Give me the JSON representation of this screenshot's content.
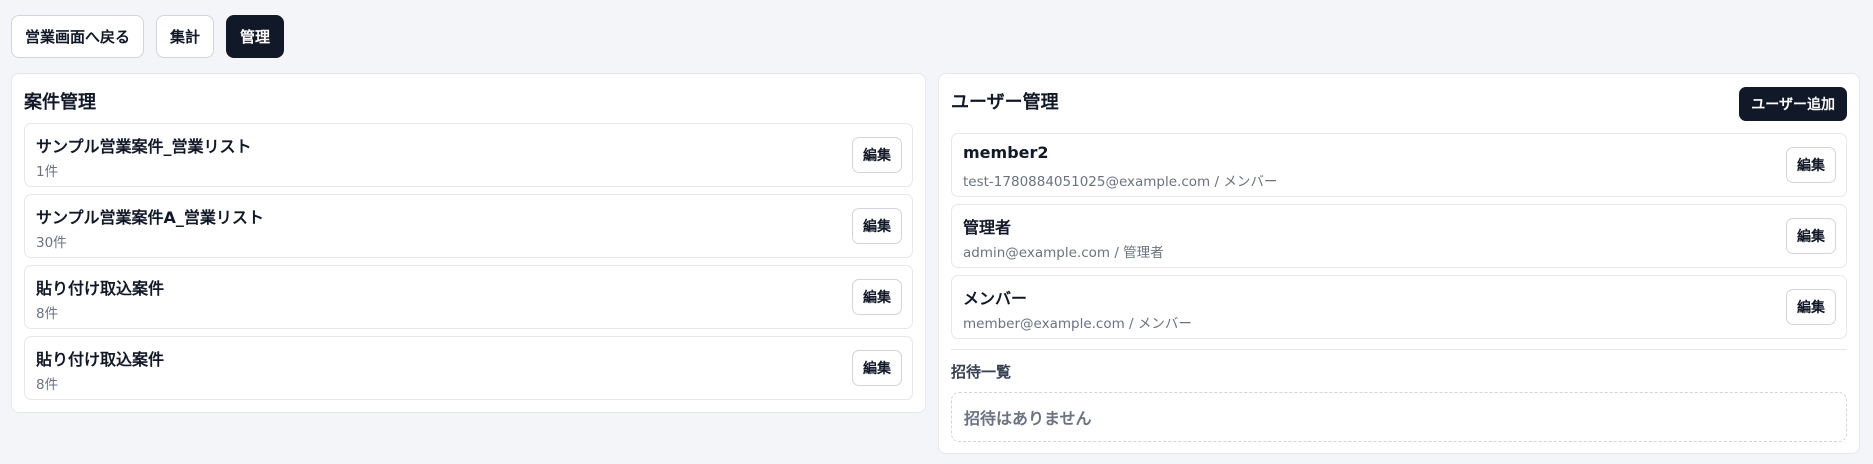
{
  "nav": {
    "back": "営業画面へ戻る",
    "summary": "集計",
    "admin": "管理"
  },
  "cases": {
    "title": "案件管理",
    "edit_label": "編集",
    "items": [
      {
        "name": "サンプル営業案件_営業リスト",
        "count": "1件"
      },
      {
        "name": "サンプル営業案件A_営業リスト",
        "count": "30件"
      },
      {
        "name": "貼り付け取込案件",
        "count": "8件"
      },
      {
        "name": "貼り付け取込案件",
        "count": "8件"
      }
    ]
  },
  "users": {
    "title": "ユーザー管理",
    "add_label": "ユーザー追加",
    "edit_label": "編集",
    "items": [
      {
        "name": "member2",
        "detail": "test-1780884051025@example.com / メンバー"
      },
      {
        "name": "管理者",
        "detail": "admin@example.com / 管理者"
      },
      {
        "name": "メンバー",
        "detail": "member@example.com / メンバー"
      }
    ],
    "invites": {
      "heading": "招待一覧",
      "empty": "招待はありません"
    }
  },
  "colors": {
    "primary_dark": "#111827",
    "background": "#f3f5f8",
    "border": "#e5e7eb",
    "muted_text": "#6b7280"
  }
}
